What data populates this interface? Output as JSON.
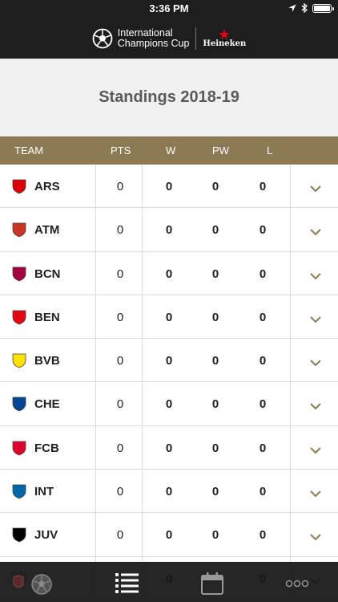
{
  "status_bar": {
    "time": "3:36 PM"
  },
  "header": {
    "logo_line1": "International",
    "logo_line2": "Champions Cup",
    "sponsor": "Heineken"
  },
  "page": {
    "title": "Standings 2018-19"
  },
  "table": {
    "columns": [
      "TEAM",
      "PTS",
      "W",
      "PW",
      "L"
    ],
    "rows": [
      {
        "team": "ARS",
        "pts": "0",
        "w": "0",
        "pw": "0",
        "l": "0",
        "crest_color": "#db0007"
      },
      {
        "team": "ATM",
        "pts": "0",
        "w": "0",
        "pw": "0",
        "l": "0",
        "crest_color": "#cb3524"
      },
      {
        "team": "BCN",
        "pts": "0",
        "w": "0",
        "pw": "0",
        "l": "0",
        "crest_color": "#a50044"
      },
      {
        "team": "BEN",
        "pts": "0",
        "w": "0",
        "pw": "0",
        "l": "0",
        "crest_color": "#e30613"
      },
      {
        "team": "BVB",
        "pts": "0",
        "w": "0",
        "pw": "0",
        "l": "0",
        "crest_color": "#fde100"
      },
      {
        "team": "CHE",
        "pts": "0",
        "w": "0",
        "pw": "0",
        "l": "0",
        "crest_color": "#034694"
      },
      {
        "team": "FCB",
        "pts": "0",
        "w": "0",
        "pw": "0",
        "l": "0",
        "crest_color": "#dc052d"
      },
      {
        "team": "INT",
        "pts": "0",
        "w": "0",
        "pw": "0",
        "l": "0",
        "crest_color": "#0068a8"
      },
      {
        "team": "JUV",
        "pts": "0",
        "w": "0",
        "pw": "0",
        "l": "0",
        "crest_color": "#000000"
      },
      {
        "team": "",
        "pts": "",
        "w": "0",
        "pw": "",
        "l": "0",
        "crest_color": "#cccccc"
      }
    ]
  },
  "tab_bar": {
    "items": [
      "team-filter-icon",
      "standings-list-icon",
      "schedule-calendar-icon",
      "more-icon"
    ]
  },
  "colors": {
    "header_bg": "#1e1e1e",
    "table_header_bg": "#8c7a55",
    "title_bg": "#f0f0f0",
    "title_text": "#5a5a5a",
    "chevron": "#8c7a55"
  }
}
